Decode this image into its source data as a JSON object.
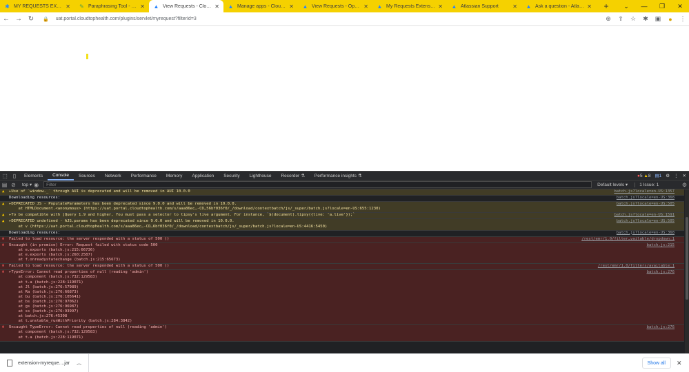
{
  "tabs": [
    {
      "title": "MY REQUESTS EXTENSION",
      "icon": "jira-icon",
      "active": false
    },
    {
      "title": "Paraphrasing Tool - QuillBot",
      "icon": "quillbot-icon",
      "active": false
    },
    {
      "title": "View Requests - Cloudtop",
      "icon": "atlassian-icon",
      "active": true
    },
    {
      "title": "Manage apps - Cloudtop",
      "icon": "atlassian-icon",
      "active": false
    },
    {
      "title": "View Requests - Open - Se",
      "icon": "atlassian-icon",
      "active": false
    },
    {
      "title": "My Requests Extension fo",
      "icon": "atlassian-icon",
      "active": false
    },
    {
      "title": "Atlassian Support",
      "icon": "atlassian-icon",
      "active": false
    },
    {
      "title": "Ask a question - Atlassian",
      "icon": "atlassian-icon",
      "active": false
    }
  ],
  "address": {
    "url": "uat.portal.cloudtophealth.com/plugins/servlet/myrequest?filterId=3"
  },
  "devtools": {
    "tabs": [
      "Elements",
      "Console",
      "Sources",
      "Network",
      "Performance",
      "Memory",
      "Application",
      "Security",
      "Lighthouse",
      "Recorder ⚗",
      "Performance insights ⚗"
    ],
    "active_tab": "Console",
    "error_count": "5",
    "warn_count": "8",
    "info_count": "1",
    "context": "top ▾",
    "filter_placeholder": "Filter",
    "levels": "Default levels ▾",
    "issues": "1 Issue: 1"
  },
  "console_rows": [
    {
      "type": "warn",
      "text": "▸Use of `window._` through AUI is deprecated and will be removed in AUI 10.0.0",
      "src": "batch.js?locale=en-US:1357"
    },
    {
      "type": "info",
      "text": "Downloading resources:",
      "src": "batch.js?locale=en-US:368"
    },
    {
      "type": "warn",
      "text": "▸DEPRECATED JS - PopulateParameters has been deprecated since 9.0.0 and will be removed in 10.0.0.\n    at HTMLDocument.<anonymous> (https://uat.portal.cloudtophealth.com/s/aaa86ec…-CD…56bf036f0/_/download/contextbatch/js/_super/batch.js?locale=en-US:655:1230)",
      "src": "batch.js?locale=en-US:505"
    },
    {
      "type": "warn",
      "text": "▸To be compatible with jQuery 1.9 and higher, You must pass a selector to tipsy's live argument. For instance, `$(document).tipsy({live: 'a.live'});`",
      "src": "batch.js?locale=en-US:1591"
    },
    {
      "type": "warn",
      "text": "▸DEPRECATED undefined - AJS.params has been deprecated since 9.0.0 and will be removed in 10.0.0.\n    at v (https://uat.portal.cloudtophealth.com/s/aaa86ec…-CD…6bf036f0/_/download/contextbatch/js/_super/batch.js?locale=en-US:4416:5450)",
      "src": "batch.js?locale=en-US:505"
    },
    {
      "type": "info",
      "text": "Downloading resources:",
      "src": "batch.js?locale=en-US:368"
    },
    {
      "type": "err",
      "text": "Failed to load resource: the server responded with a status of 500 ()",
      "src": "/rest/emr/1.0/filter…vailable/dropdown:1"
    },
    {
      "type": "err",
      "text": "Uncaught (in promise) Error: Request failed with status code 500\n    at e.exports (batch.js:215:66736)\n    at e.exports (batch.js:260:2587)\n    at f.onreadystatechange (batch.js:215:65673)",
      "src": "batch.js:215"
    },
    {
      "type": "err",
      "text": "Failed to load resource: the server responded with a status of 500 ()",
      "src": "/rest/emr/1.0/filters/available:1"
    },
    {
      "type": "err",
      "text": "▸TypeError: Cannot read properties of null (reading 'admin')\n    at component (batch.js:732:129583)\n    at t.a (batch.js:228:119071)\n    at Jl (batch.js:276:57989)\n    at Ra (batch.js:276:66873)\n    at bu (batch.js:276:105641)\n    at bs (batch.js:276:97062)\n    at gs (batch.js:276:96987)\n    at ss (batch.js:276:93997)\n    at batch.js:276:45308\n    at t.unstable_runWithPriority (batch.js:284:3842)",
      "src": "batch.js:276"
    },
    {
      "type": "err",
      "text": "Uncaught TypeError: Cannot read properties of null (reading 'admin')\n    at component (batch.js:732:129583)\n    at t.a (batch.js:228:119071)",
      "src": "batch.js:276"
    }
  ],
  "download_bar": {
    "file": "extension-myreque....jar",
    "show_all": "Show all"
  }
}
